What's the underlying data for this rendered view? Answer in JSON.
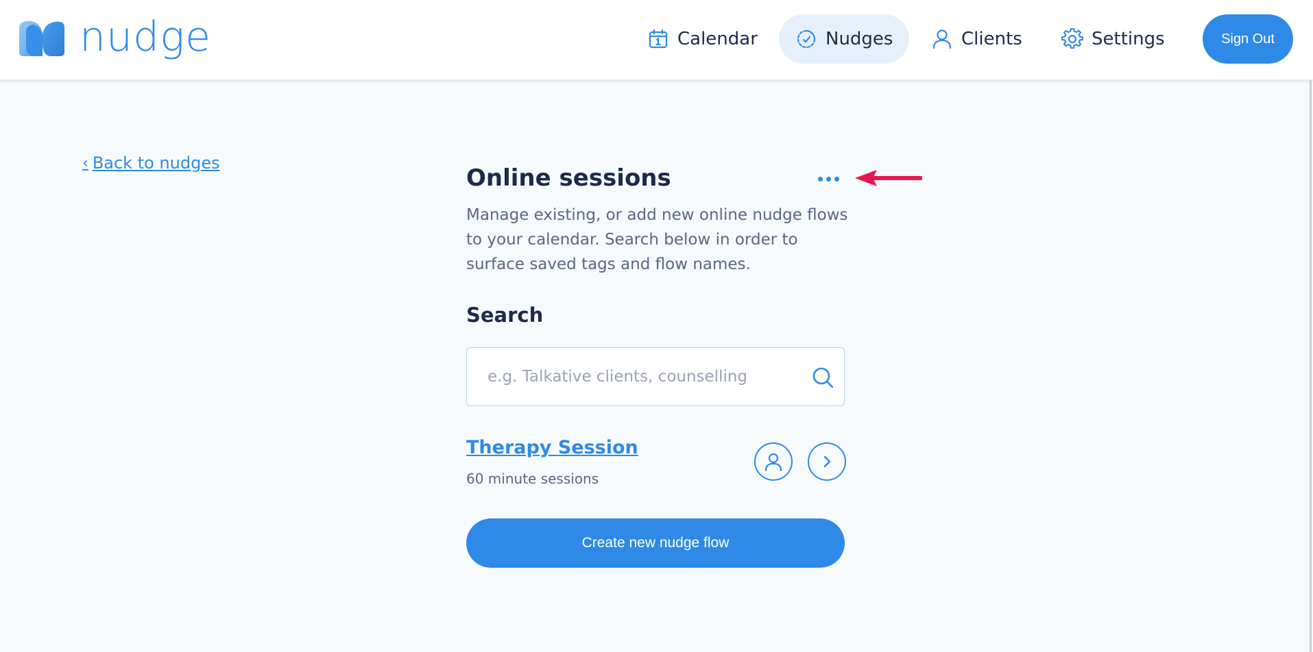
{
  "app": {
    "brand": "nudge"
  },
  "nav": {
    "items": [
      {
        "label": "Calendar",
        "icon": "calendar-icon",
        "active": false
      },
      {
        "label": "Nudges",
        "icon": "nudges-icon",
        "active": true
      },
      {
        "label": "Clients",
        "icon": "user-icon",
        "active": false
      },
      {
        "label": "Settings",
        "icon": "gear-icon",
        "active": false
      }
    ],
    "sign_out_label": "Sign Out"
  },
  "back_link": {
    "label": "Back to nudges"
  },
  "page": {
    "title": "Online sessions",
    "description": "Manage existing, or add new online nudge flows to your calendar. Search below in order to surface saved tags and flow names."
  },
  "search": {
    "label": "Search",
    "placeholder": "e.g. Talkative clients, counselling",
    "value": ""
  },
  "flows": [
    {
      "title": "Therapy Session",
      "subtitle": "60 minute sessions"
    }
  ],
  "actions": {
    "create_label": "Create new nudge flow"
  },
  "colors": {
    "accent": "#2e8ae6",
    "text_dark": "#1e2a4a",
    "text_muted": "#5c6680",
    "background": "#f6fafd",
    "nav_active_bg": "#e6f0fa",
    "annotation": "#e8164f"
  }
}
